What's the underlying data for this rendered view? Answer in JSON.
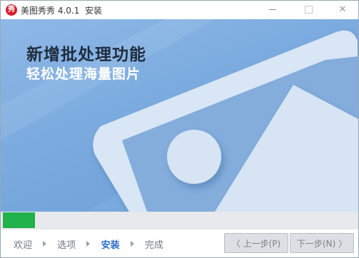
{
  "titlebar": {
    "icon_text": "秀",
    "title": "美图秀秀 4.0.1  安装",
    "minimize": "minimize",
    "maximize": "maximize",
    "close": "✕"
  },
  "banner": {
    "headline": "新增批处理功能",
    "subline": "轻松处理海量图片"
  },
  "progress": {
    "value": 0.09,
    "color": "#20b14a"
  },
  "steps": {
    "items": [
      "欢迎",
      "选项",
      "安装",
      "完成"
    ],
    "active": "安装"
  },
  "buttons": {
    "prev": "〈 上一步(P)",
    "next": "下一步(N) 〉"
  },
  "colors": {
    "accent": "#2b6fc7",
    "banner": "#7aaade"
  }
}
